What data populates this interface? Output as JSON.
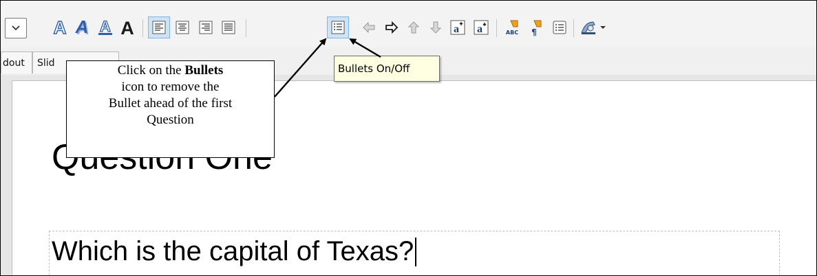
{
  "toolbar": {
    "font_dropdown": {
      "icon": "chevron-down-icon"
    },
    "text_effects": [
      {
        "name": "outline-font-icon",
        "glyph": "A"
      },
      {
        "name": "shadow-font-icon",
        "glyph": "A"
      },
      {
        "name": "underline-font-icon",
        "glyph": "A"
      },
      {
        "name": "bold-font-icon",
        "glyph": "A"
      }
    ],
    "alignment": [
      "align-left-icon",
      "align-center-icon",
      "align-right-icon",
      "align-justify-icon"
    ],
    "bullets_icon": "bulleted-list-icon",
    "promote_demote": [
      "arrow-left-icon",
      "arrow-right-icon",
      "arrow-up-icon",
      "arrow-down-icon"
    ],
    "superscript_glyph": "a",
    "subscript_glyph": "a",
    "spellcheck_glyph": "ABC",
    "formatting_marks_glyph": "¶"
  },
  "tabs": {
    "handout_partial": "dout",
    "slide_sorter_partial": "Slid"
  },
  "tooltip": {
    "text": "Bullets On/Off"
  },
  "callout": {
    "line1_prefix": "Click on the ",
    "line1_bold": "Bullets",
    "line2": "icon to remove the",
    "line3": "Bullet ahead of the first",
    "line4": "Question"
  },
  "slide": {
    "title": "Question One",
    "content": "Which is the capital of Texas?"
  },
  "colors": {
    "active_button_bg": "#cde3f7",
    "active_button_border": "#7eb4ea",
    "tooltip_bg": "#ffffe1",
    "arrow_blue": "#1d5fa8",
    "accent_yellow": "#f0a020"
  }
}
